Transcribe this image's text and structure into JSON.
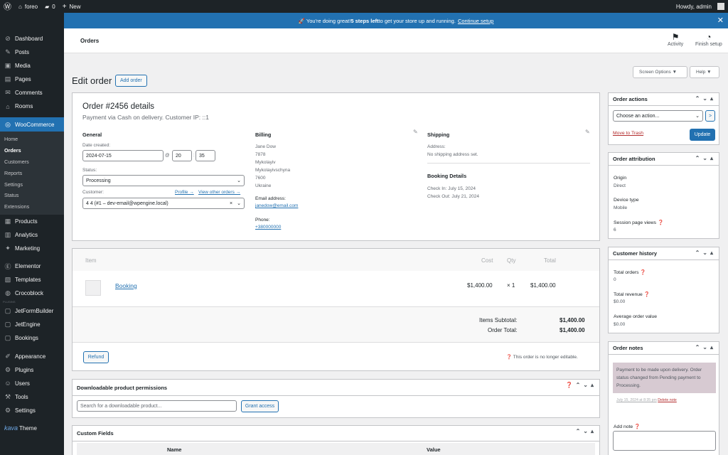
{
  "adminbar": {
    "site": "foreo",
    "comments": "0",
    "new": "New",
    "howdy": "Howdy, admin"
  },
  "sidebar": {
    "items": [
      {
        "icon": "⊘",
        "label": "Dashboard"
      },
      {
        "icon": "✎",
        "label": "Posts"
      },
      {
        "icon": "▣",
        "label": "Media"
      },
      {
        "icon": "▤",
        "label": "Pages"
      },
      {
        "icon": "✉",
        "label": "Comments"
      },
      {
        "icon": "⌂",
        "label": "Rooms"
      }
    ],
    "woo": {
      "label": "WooCommerce",
      "sub": [
        "Home",
        "Orders",
        "Customers",
        "Reports",
        "Settings",
        "Status",
        "Extensions"
      ]
    },
    "items2": [
      {
        "icon": "▦",
        "label": "Products"
      },
      {
        "icon": "▥",
        "label": "Analytics"
      },
      {
        "icon": "✦",
        "label": "Marketing"
      }
    ],
    "items3": [
      {
        "icon": "Ⓔ",
        "label": "Elementor"
      },
      {
        "icon": "▧",
        "label": "Templates"
      },
      {
        "icon": "◍",
        "label": "Crocoblock"
      }
    ],
    "tiny": "PLUGINS",
    "items4": [
      {
        "icon": "▢",
        "label": "JetFormBuilder"
      },
      {
        "icon": "▢",
        "label": "JetEngine"
      },
      {
        "icon": "▢",
        "label": "Bookings"
      }
    ],
    "items5": [
      {
        "icon": "✐",
        "label": "Appearance"
      },
      {
        "icon": "⚙",
        "label": "Plugins"
      },
      {
        "icon": "☺",
        "label": "Users"
      },
      {
        "icon": "⚒",
        "label": "Tools"
      },
      {
        "icon": "⚙",
        "label": "Settings"
      }
    ],
    "theme": {
      "logo": "kava",
      "label": "Theme"
    }
  },
  "notice": {
    "pre": "🚀 You're doing great! ",
    "bold": "5 steps left",
    "post": " to get your store up and running.",
    "link": "Continue setup"
  },
  "wchead": {
    "title": "Orders",
    "activity": "Activity",
    "finish": "Finish setup"
  },
  "screen_options": "Screen Options ▼",
  "help": "Help ▼",
  "page": {
    "title": "Edit order",
    "add": "Add order"
  },
  "order": {
    "title": "Order #2456 details",
    "sub": "Payment via Cash on delivery. Customer IP: ::1",
    "general": "General",
    "date_label": "Date created:",
    "date": "2024-07-15",
    "at": "@",
    "hour": "20",
    "min": "35",
    "colon": ":",
    "status_label": "Status:",
    "status": "Processing",
    "customer_label": "Customer:",
    "profile": "Profile →",
    "other": "View other orders →",
    "customer": "4 4 (#1 – dev-email@wpengine.local)",
    "billing": "Billing",
    "bill_lines": [
      "Jane Dow",
      "7878",
      "Mykolayiv",
      "Mykolayivschyna",
      "7600",
      "Ukraine"
    ],
    "email_label": "Email address:",
    "email": "janedow@email.com",
    "phone_label": "Phone:",
    "phone": "+380000000",
    "shipping": "Shipping",
    "addr_label": "Address:",
    "no_addr": "No shipping address set.",
    "booking": "Booking Details",
    "checkin": "Check In: July 15, 2024",
    "checkout": "Check Out: July 21, 2024"
  },
  "items": {
    "h_item": "Item",
    "h_cost": "Cost",
    "h_qty": "Qty",
    "h_total": "Total",
    "name": "Booking",
    "cost": "$1,400.00",
    "qty": "× 1",
    "total": "$1,400.00",
    "sub_label": "Items Subtotal:",
    "sub_val": "$1,400.00",
    "tot_label": "Order Total:",
    "tot_val": "$1,400.00",
    "refund": "Refund",
    "noedit": "This order is no longer editable."
  },
  "downloads": {
    "title": "Downloadable product permissions",
    "placeholder": "Search for a downloadable product...",
    "grant": "Grant access"
  },
  "custom": {
    "title": "Custom Fields",
    "name": "Name",
    "value": "Value"
  },
  "actions": {
    "title": "Order actions",
    "choose": "Choose an action...",
    "go": ">",
    "trash": "Move to Trash",
    "update": "Update"
  },
  "attribution": {
    "title": "Order attribution",
    "origin_label": "Origin",
    "origin": "Direct",
    "device_label": "Device type",
    "device": "Mobile",
    "spv_label": "Session page views",
    "spv": "6"
  },
  "history": {
    "title": "Customer history",
    "to_label": "Total orders",
    "to": "0",
    "tr_label": "Total revenue",
    "tr": "$0.00",
    "aov_label": "Average order value",
    "aov": "$0.00"
  },
  "notes": {
    "title": "Order notes",
    "note": "Payment to be made upon delivery. Order status changed from Pending payment to Processing.",
    "meta": "July 15, 2024 at 8:35 pm",
    "del": "Delete note",
    "add": "Add note"
  },
  "colors": {
    "accent": "#2271b1",
    "sidebar": "#1d2327",
    "note": "#d7cad2"
  }
}
